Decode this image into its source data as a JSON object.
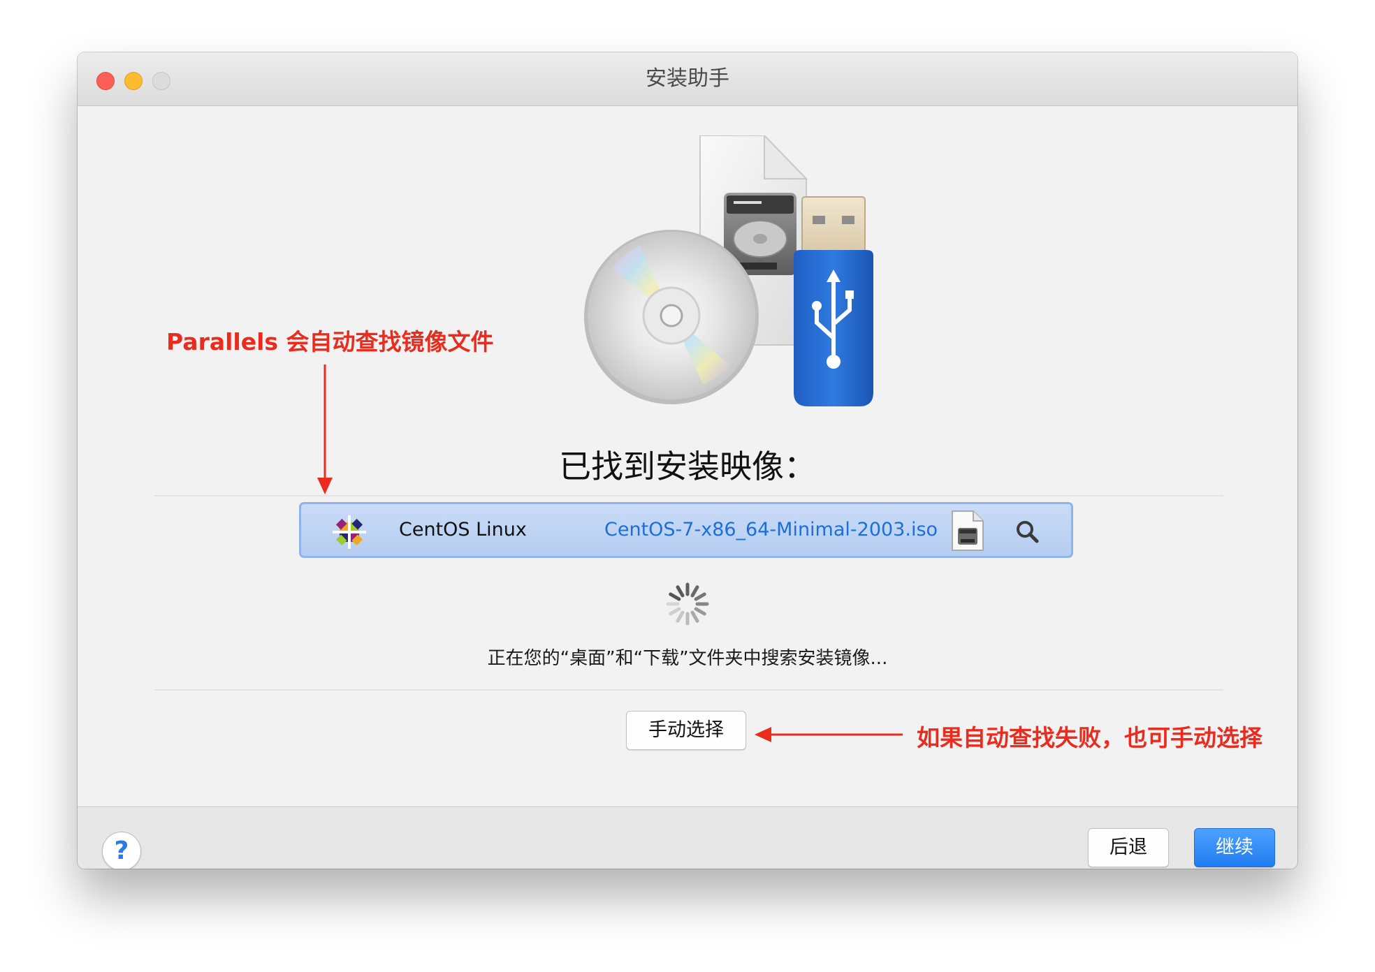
{
  "window": {
    "title": "安装助手"
  },
  "main": {
    "heading": "已找到安装映像：",
    "image_row": {
      "os_name": "CentOS Linux",
      "file_name": "CentOS-7-x86_64-Minimal-2003.iso"
    },
    "search_status": "正在您的“桌面”和“下载”文件夹中搜索安装镜像...",
    "manual_select_label": "手动选择"
  },
  "footer": {
    "help_label": "?",
    "back_label": "后退",
    "continue_label": "继续"
  },
  "annotations": {
    "top": "Parallels 会自动查找镜像文件",
    "right": "如果自动查找失败，也可手动选择",
    "color": "#ea2c1f"
  },
  "colors": {
    "accent": "#1f7cf0",
    "link": "#1e6ed8",
    "row_highlight": "#c2d7f5"
  },
  "icons": [
    "disc-icon",
    "hard-drive-icon",
    "usb-drive-icon",
    "centos-logo-icon",
    "iso-file-icon",
    "search-icon",
    "spinner-icon",
    "help-icon"
  ]
}
